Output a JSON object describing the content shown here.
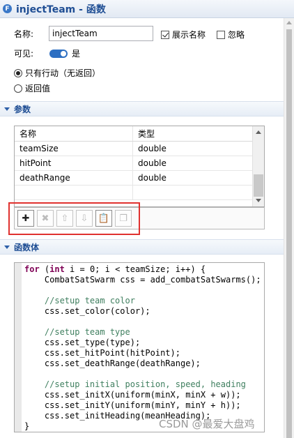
{
  "header": {
    "icon_letter": "F",
    "title": "injectTeam - 函数"
  },
  "form": {
    "name_label": "名称:",
    "name_value": "injectTeam",
    "show_name_label": "展示名称",
    "show_name_checked": true,
    "ignore_label": "忽略",
    "ignore_checked": false,
    "visible_label": "可见:",
    "visible_value": "是",
    "radio_action_only": "只有行动（无返回）",
    "radio_return_value": "返回值"
  },
  "params_section": {
    "title": "参数",
    "columns": [
      "名称",
      "类型"
    ],
    "rows": [
      [
        "teamSize",
        "double"
      ],
      [
        "hitPoint",
        "double"
      ],
      [
        "deathRange",
        "double"
      ],
      [
        "",
        ""
      ]
    ]
  },
  "toolbar": {
    "buttons": [
      {
        "name": "add-button",
        "glyph": "✚",
        "enabled": true
      },
      {
        "name": "delete-button",
        "glyph": "✖",
        "enabled": false
      },
      {
        "name": "move-up-button",
        "glyph": "⇧",
        "enabled": false
      },
      {
        "name": "move-down-button",
        "glyph": "⇩",
        "enabled": false
      },
      {
        "name": "paste-button",
        "glyph": "📋",
        "enabled": true
      },
      {
        "name": "copy-button",
        "glyph": "❐",
        "enabled": false
      }
    ]
  },
  "body_section": {
    "title": "函数体"
  },
  "code_lines": [
    "for (int i = 0; i < teamSize; i++) {",
    "    CombatSatSwarm css = add_combatSatSwarms();",
    "",
    "    //setup team color",
    "    css.set_color(color);",
    "",
    "    //setup team type",
    "    css.set_type(type);",
    "    css.set_hitPoint(hitPoint);",
    "    css.set_deathRange(deathRange);",
    "",
    "    //setup initial position, speed, heading",
    "    css.set_initX(uniform(minX, minX + w));",
    "    css.set_initY(uniform(minY, minY + h));",
    "    css.set_initHeading(meanHeading);",
    "}"
  ],
  "watermark": "CSDN @最爱大盘鸡"
}
